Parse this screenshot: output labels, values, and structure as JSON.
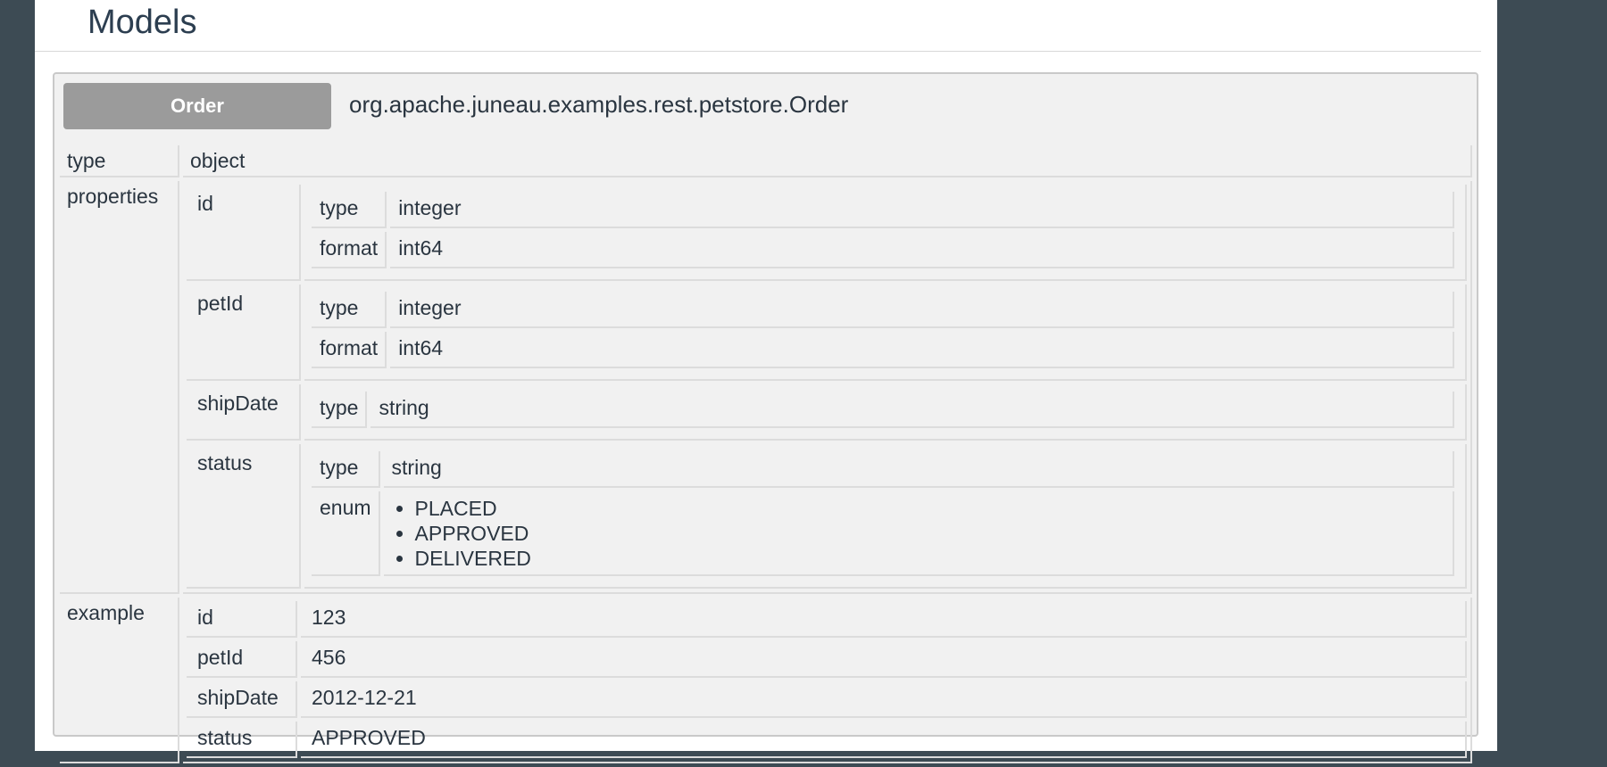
{
  "section": {
    "title": "Models"
  },
  "model": {
    "badge": "Order",
    "class_name": "org.apache.juneau.examples.rest.petstore.Order",
    "type_key": "type",
    "type_value": "object",
    "properties_key": "properties",
    "properties": [
      {
        "name": "id",
        "attrs": [
          {
            "key": "type",
            "value": "integer"
          },
          {
            "key": "format",
            "value": "int64"
          }
        ]
      },
      {
        "name": "petId",
        "attrs": [
          {
            "key": "type",
            "value": "integer"
          },
          {
            "key": "format",
            "value": "int64"
          }
        ]
      },
      {
        "name": "shipDate",
        "attrs": [
          {
            "key": "type",
            "value": "string"
          }
        ]
      },
      {
        "name": "status",
        "attrs": [
          {
            "key": "type",
            "value": "string"
          }
        ],
        "enum_key": "enum",
        "enum": [
          "PLACED",
          "APPROVED",
          "DELIVERED"
        ]
      }
    ],
    "example_key": "example",
    "example": [
      {
        "key": "id",
        "value": "123"
      },
      {
        "key": "petId",
        "value": "456"
      },
      {
        "key": "shipDate",
        "value": "2012-12-21"
      },
      {
        "key": "status",
        "value": "APPROVED"
      }
    ]
  },
  "colors": {
    "background": "#3d4b54",
    "panel": "#f1f1f1",
    "badge": "#9b9b9b"
  }
}
